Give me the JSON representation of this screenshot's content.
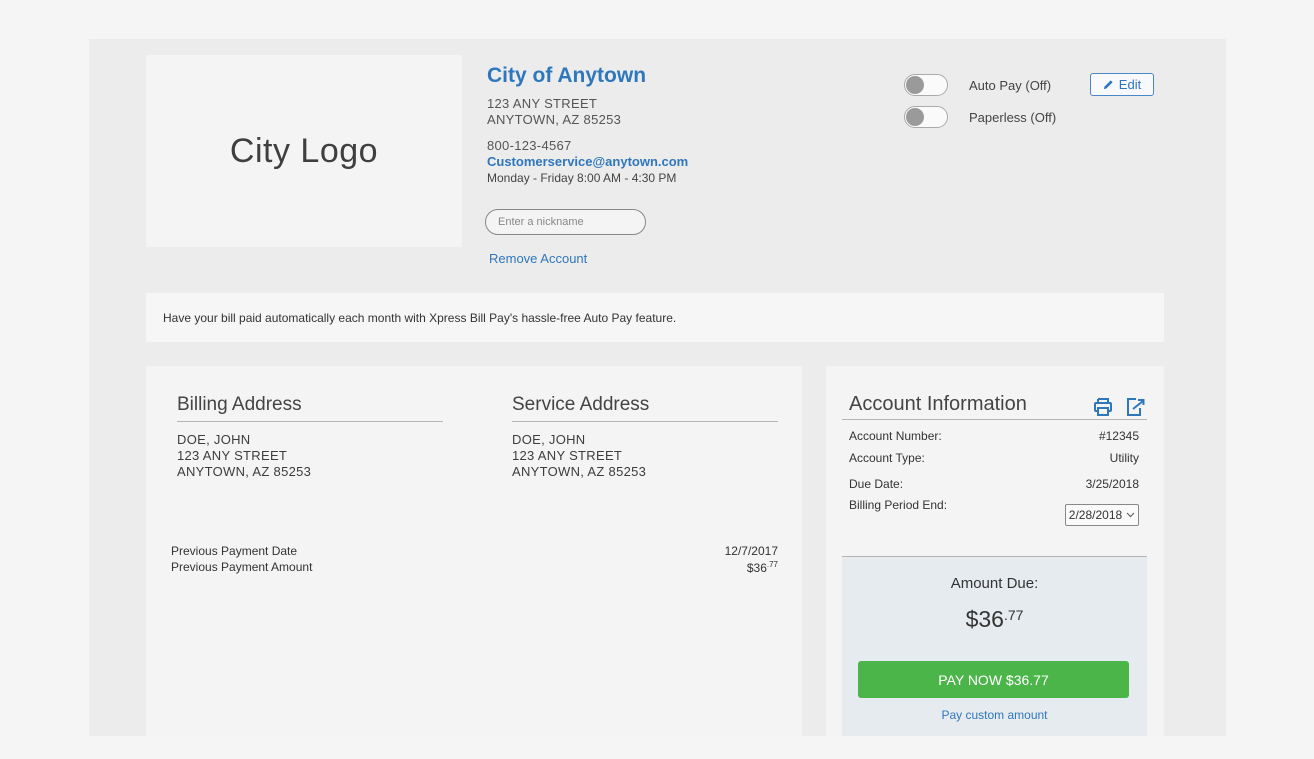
{
  "header": {
    "logo_text": "City Logo",
    "city_name": "City of Anytown",
    "address_line1": "123 ANY STREET",
    "address_line2": "ANYTOWN, AZ 85253",
    "phone": "800-123-4567",
    "email": "Customerservice@anytown.com",
    "hours": "Monday - Friday 8:00 AM - 4:30 PM",
    "nickname_placeholder": "Enter a nickname",
    "remove_label": "Remove Account"
  },
  "settings": {
    "auto_pay_label": "Auto Pay (Off)",
    "paperless_label": "Paperless (Off)",
    "edit_label": "Edit"
  },
  "banner": {
    "text": "Have your bill paid automatically each month with Xpress Bill Pay's hassle-free Auto Pay feature."
  },
  "billing_address": {
    "heading": "Billing Address",
    "lines": [
      "DOE, JOHN",
      "123 ANY STREET",
      "ANYTOWN, AZ 85253"
    ]
  },
  "service_address": {
    "heading": "Service Address",
    "lines": [
      "DOE, JOHN",
      "123 ANY STREET",
      "ANYTOWN, AZ 85253"
    ]
  },
  "previous_payment": {
    "date_label": "Previous Payment Date",
    "date_value": "12/7/2017",
    "amount_label": "Previous Payment Amount",
    "amount_whole": "$36",
    "amount_cents": ".77"
  },
  "account_info": {
    "heading": "Account Information",
    "number_label": "Account Number:",
    "number_value": "#12345",
    "type_label": "Account Type:",
    "type_value": "Utility",
    "due_date_label": "Due Date:",
    "due_date_value": "3/25/2018",
    "period_label": "Billing Period End:",
    "period_value": "2/28/2018",
    "amount_due_label": "Amount Due:",
    "amount_due_whole": "$36",
    "amount_due_cents": ".77",
    "pay_button_label": "PAY NOW $36.77",
    "custom_link": "Pay custom amount"
  },
  "colors": {
    "link_blue": "#2f77bd",
    "pay_green": "#4cb54a"
  },
  "icons": [
    "pencil-icon",
    "printer-icon",
    "export-icon",
    "chevron-down-icon"
  ]
}
